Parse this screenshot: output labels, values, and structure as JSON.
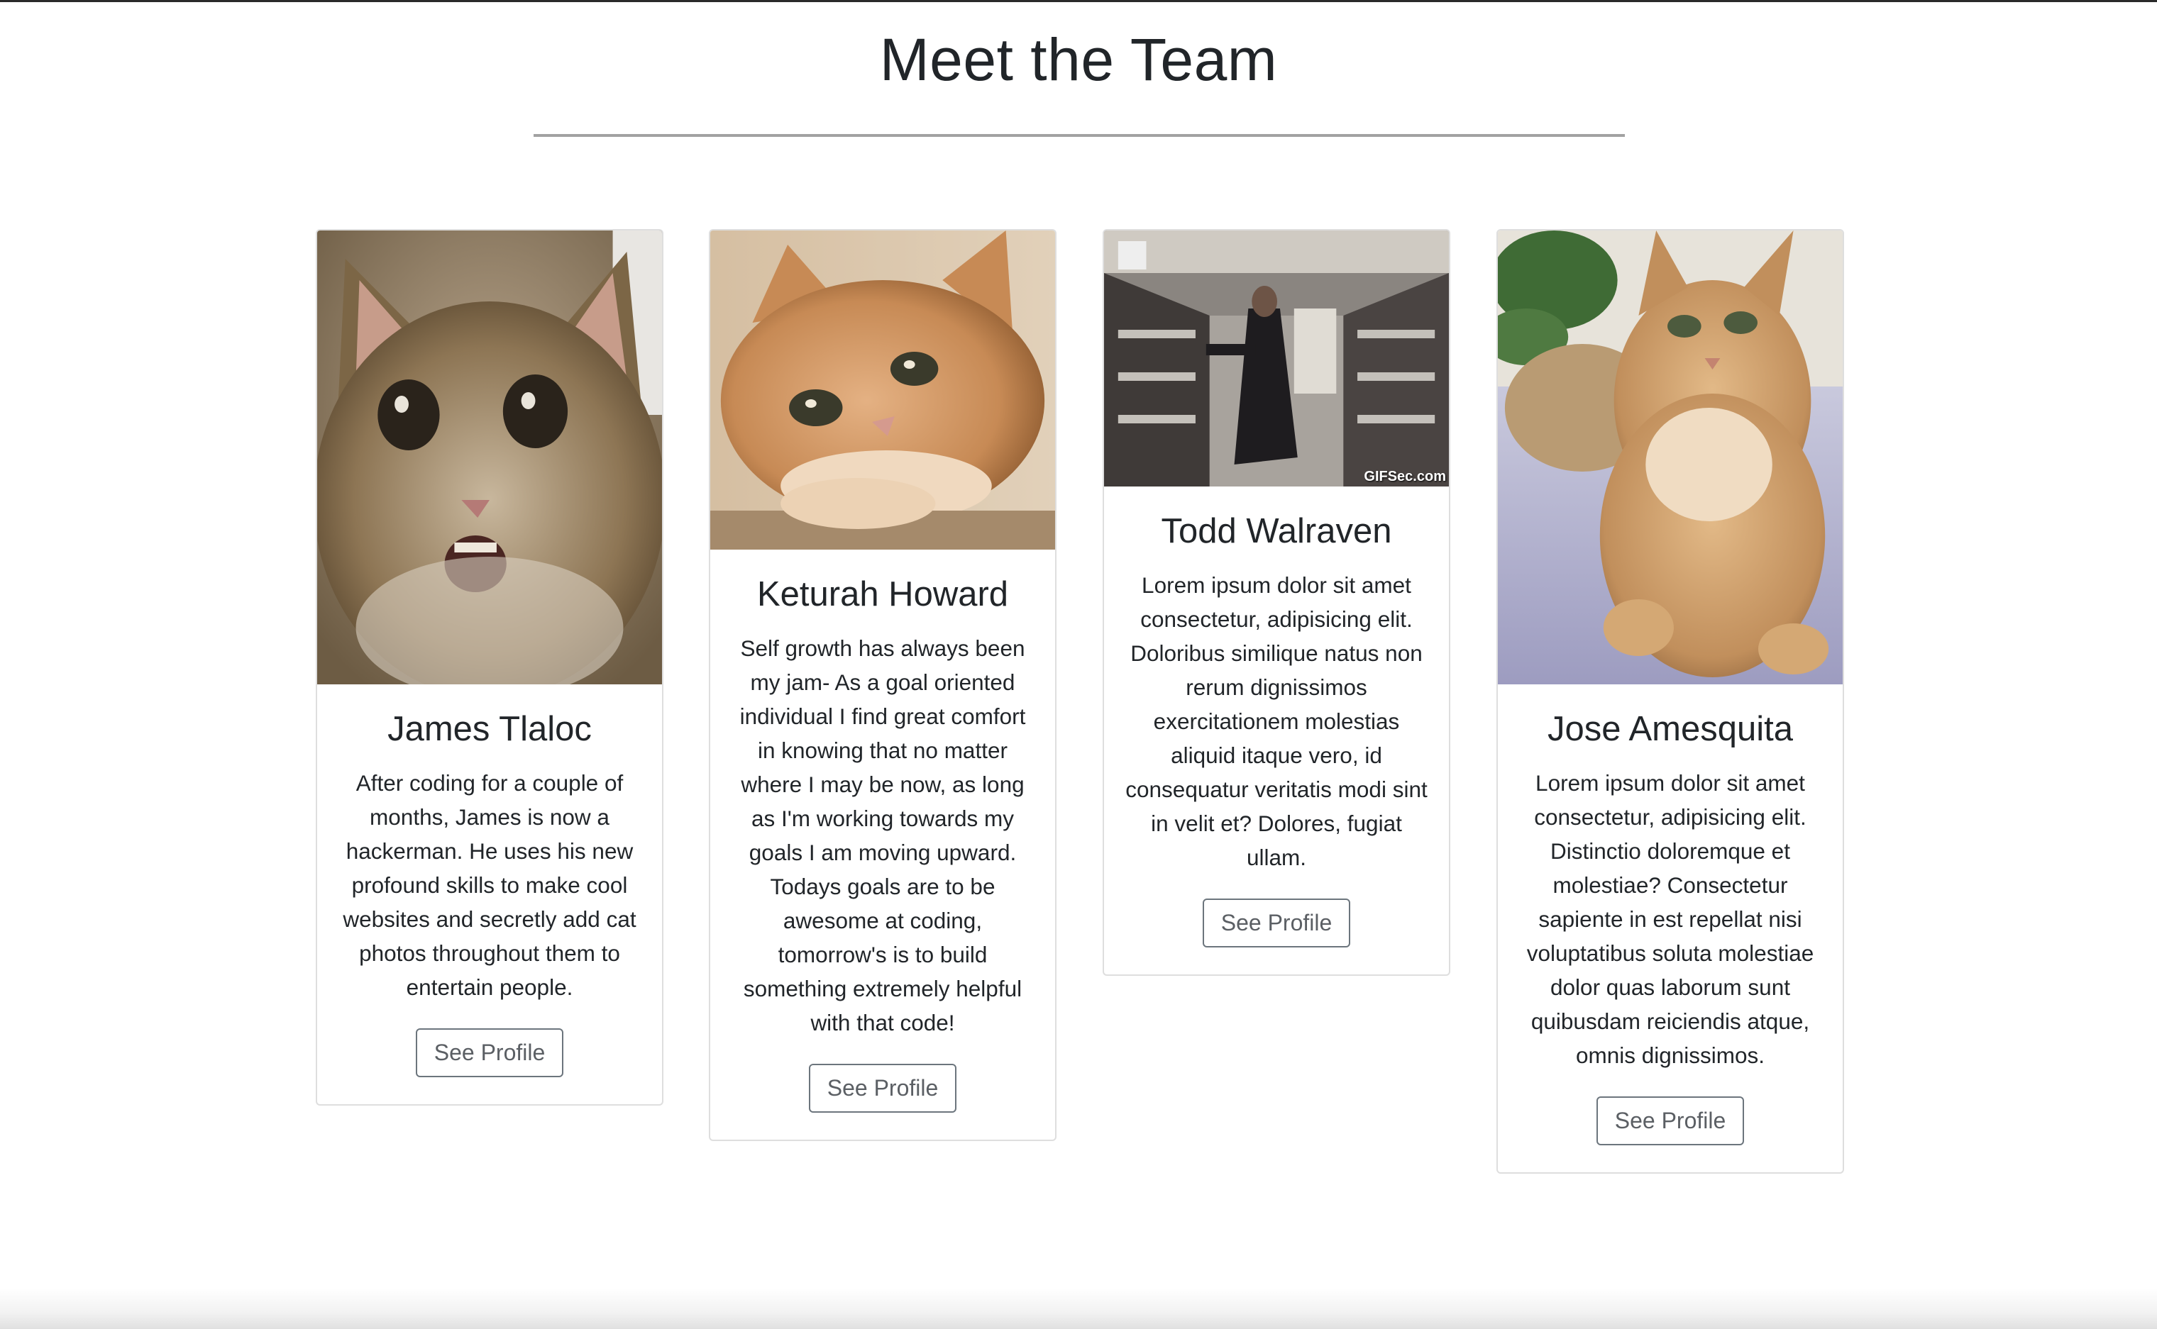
{
  "page": {
    "title": "Meet the Team"
  },
  "team": [
    {
      "name": "James Tlaloc",
      "bio": "After coding for a couple of months, James is now a hackerman. He uses his new profound skills to make cool websites and secretly add cat photos throughout them to entertain people.",
      "button_label": "See Profile",
      "photo": "cat-photo-surprised-tabby"
    },
    {
      "name": "Keturah Howard",
      "bio": "Self growth has always been my jam- As a goal oriented individual I find great comfort in knowing that no matter where I may be now, as long as I'm working towards my goals I am moving upward. Todays goals are to be awesome at coding, tomorrow's is to build something extremely helpful with that code!",
      "button_label": "See Profile",
      "photo": "cat-photo-orange-resting"
    },
    {
      "name": "Todd Walraven",
      "bio": "Lorem ipsum dolor sit amet consectetur, adipisicing elit. Doloribus similique natus non rerum dignissimos exercitationem molestias aliquid itaque vero, id consequatur veritatis modi sint in velit et? Dolores, fugiat ullam.",
      "button_label": "See Profile",
      "photo": "gif-store-aisle",
      "photo_caption": "GIFSec.com"
    },
    {
      "name": "Jose Amesquita",
      "bio": "Lorem ipsum dolor sit amet consectetur, adipisicing elit. Distinctio doloremque et molestiae? Consectetur sapiente in est repellat nisi voluptatibus soluta molestiae dolor quas laborum sunt quibusdam reiciendis atque, omnis dignissimos.",
      "button_label": "See Profile",
      "photo": "cat-photo-golden-on-bed"
    }
  ]
}
